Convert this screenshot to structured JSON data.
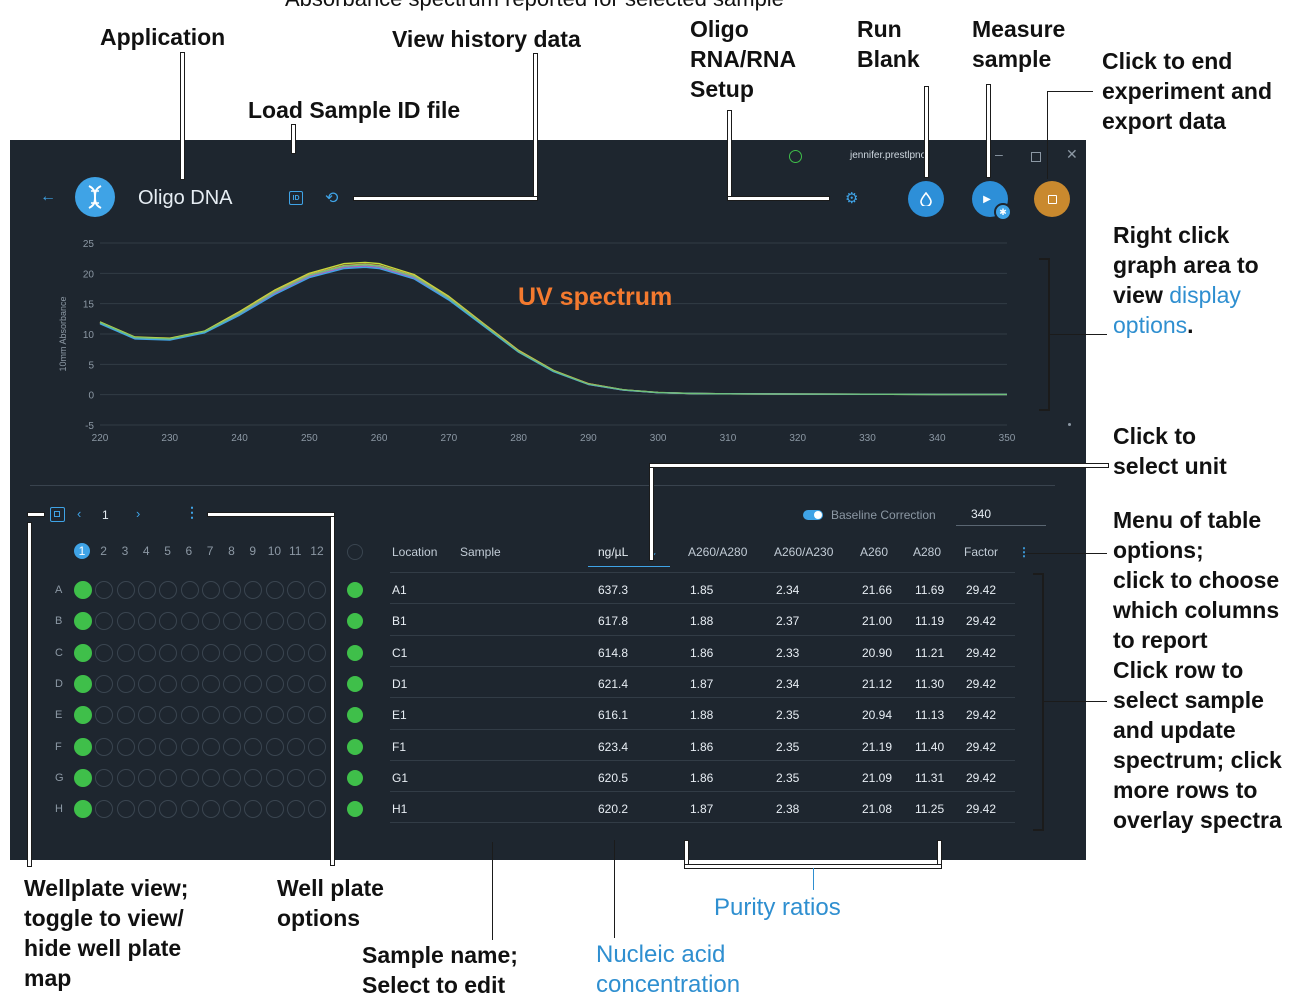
{
  "annotations": {
    "top_partial": "Absorbance spectrum reported for selected sample",
    "application": "Application",
    "view_history": "View history data",
    "load_sample_id": "Load Sample ID file",
    "oligo_setup": "Oligo\nRNA/RNA\nSetup",
    "run_blank": "Run\nBlank",
    "measure_sample": "Measure\nsample",
    "end_experiment": "Click to end\nexperiment and\nexport data",
    "right_click_prefix": "Right click\ngraph area to\nview ",
    "display_options": "display\noptions",
    "right_click_suffix": ".",
    "uv_spectrum": "UV spectrum",
    "select_unit": "Click to\nselect unit",
    "table_menu": "Menu of table\noptions;\nclick to choose\nwhich columns\nto report",
    "click_row": "Click row to\nselect sample\nand update\nspectrum; click\nmore rows to\noverlay spectra",
    "wellplate_view": "Wellplate view;\ntoggle to view/\nhide well plate\nmap",
    "wellplate_options": "Well plate\noptions",
    "sample_name": "Sample name;\nSelect to edit",
    "nucleic_acid": "Nucleic acid\nconcentration",
    "purity_ratios": "Purity ratios"
  },
  "app": {
    "title": "Oligo DNA",
    "user": "jennifer.prestlpno",
    "id_button_label": "ID",
    "baseline_label": "Baseline Correction",
    "baseline_value": "340",
    "page_number": "1",
    "colors": {
      "background": "#1e262f",
      "accent": "#3fa3e6",
      "stop": "#c9892e",
      "well_green": "#3fbf4a"
    }
  },
  "chart_data": {
    "type": "line",
    "ylabel": "10mm Absorbance",
    "xlim": [
      220,
      350
    ],
    "ylim": [
      -5,
      25
    ],
    "x_ticks": [
      220,
      230,
      240,
      250,
      260,
      270,
      280,
      290,
      300,
      310,
      320,
      330,
      340,
      350
    ],
    "y_ticks": [
      25,
      20,
      15,
      10,
      5,
      0,
      -5
    ],
    "grid": true,
    "x": [
      220,
      225,
      230,
      235,
      240,
      245,
      250,
      255,
      258,
      260,
      265,
      270,
      275,
      280,
      285,
      290,
      295,
      300,
      305,
      310,
      320,
      330,
      340,
      350
    ],
    "series": [
      {
        "color": "#c7d93c",
        "values": [
          12.0,
          9.5,
          9.3,
          10.5,
          13.7,
          17.2,
          20.0,
          21.6,
          21.8,
          21.6,
          19.8,
          16.2,
          11.7,
          7.3,
          4.0,
          1.8,
          0.8,
          0.35,
          0.2,
          0.15,
          0.1,
          0.08,
          0.05,
          0.05
        ]
      },
      {
        "color": "#e0a248",
        "values": [
          11.9,
          9.4,
          9.2,
          10.4,
          13.5,
          17.0,
          19.8,
          21.3,
          21.5,
          21.3,
          19.6,
          16.0,
          11.6,
          7.2,
          3.9,
          1.8,
          0.8,
          0.34,
          0.2,
          0.15,
          0.1,
          0.07,
          0.05,
          0.05
        ]
      },
      {
        "color": "#b45fc4",
        "values": [
          11.8,
          9.3,
          9.1,
          10.3,
          13.3,
          16.7,
          19.5,
          21.0,
          21.2,
          21.0,
          19.3,
          15.8,
          11.4,
          7.1,
          3.9,
          1.7,
          0.75,
          0.33,
          0.2,
          0.15,
          0.1,
          0.07,
          0.05,
          0.05
        ]
      },
      {
        "color": "#3fa3e6",
        "values": [
          11.7,
          9.2,
          9.0,
          10.2,
          13.1,
          16.5,
          19.3,
          20.8,
          21.0,
          20.8,
          19.1,
          15.6,
          11.3,
          7.0,
          3.8,
          1.7,
          0.75,
          0.33,
          0.2,
          0.15,
          0.1,
          0.07,
          0.05,
          0.05
        ]
      },
      {
        "color": "#6fc07a",
        "values": [
          11.9,
          9.4,
          9.2,
          10.4,
          13.4,
          16.9,
          19.7,
          21.2,
          21.4,
          21.2,
          19.5,
          15.9,
          11.5,
          7.1,
          3.9,
          1.75,
          0.8,
          0.34,
          0.2,
          0.15,
          0.1,
          0.07,
          0.05,
          0.05
        ]
      }
    ]
  },
  "plate": {
    "columns": [
      "1",
      "2",
      "3",
      "4",
      "5",
      "6",
      "7",
      "8",
      "9",
      "10",
      "11",
      "12"
    ],
    "rows": [
      "A",
      "B",
      "C",
      "D",
      "E",
      "F",
      "G",
      "H"
    ]
  },
  "table": {
    "headers": {
      "location": "Location",
      "sample": "Sample",
      "unit": "ng/µL",
      "a260_a280": "A260/A280",
      "a260_a230": "A260/A230",
      "a260": "A260",
      "a280": "A280",
      "factor": "Factor"
    },
    "rows": [
      {
        "location": "A1",
        "conc": "637.3",
        "r1": "1.85",
        "r2": "2.34",
        "a260": "21.66",
        "a280": "11.69",
        "factor": "29.42"
      },
      {
        "location": "B1",
        "conc": "617.8",
        "r1": "1.88",
        "r2": "2.37",
        "a260": "21.00",
        "a280": "11.19",
        "factor": "29.42"
      },
      {
        "location": "C1",
        "conc": "614.8",
        "r1": "1.86",
        "r2": "2.33",
        "a260": "20.90",
        "a280": "11.21",
        "factor": "29.42"
      },
      {
        "location": "D1",
        "conc": "621.4",
        "r1": "1.87",
        "r2": "2.34",
        "a260": "21.12",
        "a280": "11.30",
        "factor": "29.42"
      },
      {
        "location": "E1",
        "conc": "616.1",
        "r1": "1.88",
        "r2": "2.35",
        "a260": "20.94",
        "a280": "11.13",
        "factor": "29.42"
      },
      {
        "location": "F1",
        "conc": "623.4",
        "r1": "1.86",
        "r2": "2.35",
        "a260": "21.19",
        "a280": "11.40",
        "factor": "29.42"
      },
      {
        "location": "G1",
        "conc": "620.5",
        "r1": "1.86",
        "r2": "2.35",
        "a260": "21.09",
        "a280": "11.31",
        "factor": "29.42"
      },
      {
        "location": "H1",
        "conc": "620.2",
        "r1": "1.87",
        "r2": "2.38",
        "a260": "21.08",
        "a280": "11.25",
        "factor": "29.42"
      }
    ]
  }
}
